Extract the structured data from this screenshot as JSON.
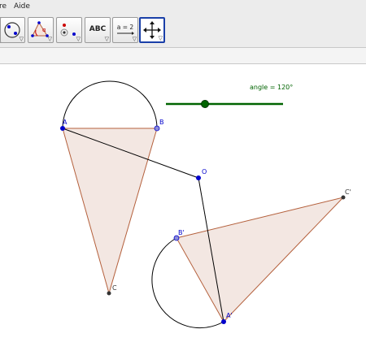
{
  "menu": {
    "items": [
      "re",
      "Aide"
    ]
  },
  "toolbar": {
    "tools": [
      {
        "name": "circle-tool",
        "icon": "circle-through-points-icon"
      },
      {
        "name": "angle-tool",
        "icon": "angle-icon"
      },
      {
        "name": "rotation-tool",
        "icon": "rotate-around-point-icon"
      },
      {
        "name": "text-tool",
        "icon": "text-icon",
        "label": "ABC"
      },
      {
        "name": "slider-tool",
        "icon": "slider-icon",
        "label": "a = 2"
      },
      {
        "name": "move-view-tool",
        "icon": "move-arrows-icon",
        "selected": true
      }
    ]
  },
  "canvas": {
    "slider": {
      "label": "angle = 120°",
      "value_degrees": 120,
      "color": "#006400"
    },
    "points": {
      "A": "A",
      "B": "B",
      "C": "C",
      "O": "O",
      "A_prime": "A'",
      "B_prime": "B'",
      "C_prime": "C'"
    },
    "colors": {
      "point": "#0000cc",
      "triangle_fill": "#f3e7e2",
      "triangle_stroke": "#b4603c",
      "line": "#000000"
    }
  }
}
